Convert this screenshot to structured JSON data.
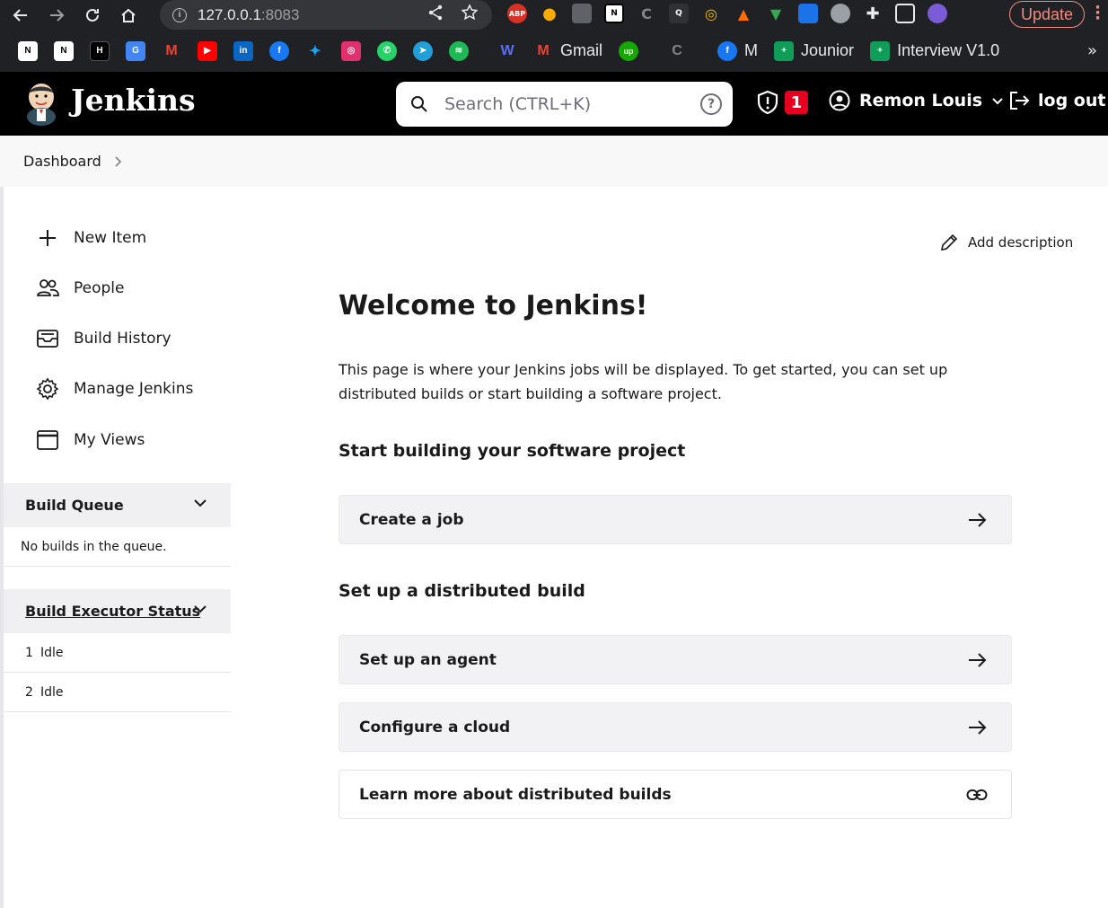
{
  "browser": {
    "url_host": "127.0.0.1",
    "url_port": ":8083",
    "update_label": "Update",
    "bookmarks": {
      "gmail": "Gmail",
      "m": "M",
      "jounior": "Jounior",
      "interview": "Interview V1.0"
    }
  },
  "header": {
    "brand": "Jenkins",
    "search_placeholder": "Search (CTRL+K)",
    "security_count": "1",
    "user_name": "Remon Louis",
    "logout_label": "log out"
  },
  "breadcrumb": {
    "dashboard": "Dashboard"
  },
  "sidebar": {
    "tasks": [
      {
        "label": "New Item"
      },
      {
        "label": "People"
      },
      {
        "label": "Build History"
      },
      {
        "label": "Manage Jenkins"
      },
      {
        "label": "My Views"
      }
    ],
    "build_queue": {
      "title": "Build Queue",
      "empty": "No builds in the queue."
    },
    "executors": {
      "title": "Build Executor Status",
      "rows": [
        {
          "num": "1",
          "status": "Idle"
        },
        {
          "num": "2",
          "status": "Idle"
        }
      ]
    }
  },
  "main": {
    "add_description": "Add description",
    "welcome": "Welcome to Jenkins!",
    "intro": "This page is where your Jenkins jobs will be displayed. To get started, you can set up distributed builds or start building a software project.",
    "start_title": "Start building your software project",
    "create_job": "Create a job",
    "distributed_title": "Set up a distributed build",
    "setup_agent": "Set up an agent",
    "configure_cloud": "Configure a cloud",
    "learn_more": "Learn more about distributed builds"
  },
  "colors": {
    "header_bg": "#000000",
    "badge_red": "#e6001f",
    "card_bg": "#f2f2f5"
  }
}
